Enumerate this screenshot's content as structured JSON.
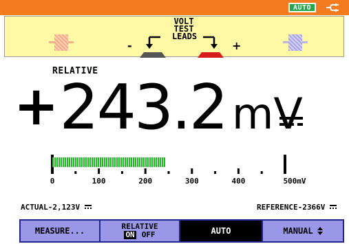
{
  "status_bar": {
    "mode_badge": "AUTO",
    "power_icon": "ac-plug-icon",
    "bar_color": "#f47b20",
    "badge_color": "#22a84a"
  },
  "connection_panel": {
    "title_lines": [
      "VOLT",
      "TEST",
      "LEADS"
    ],
    "minus_sign": "-",
    "plus_sign": "+",
    "left_probe_color": "#f6a87e",
    "right_probe_color": "#a7a3e6",
    "panel_color": "#fff9a6"
  },
  "measurement": {
    "mode": "RELATIVE",
    "sign": "+",
    "value": "243.2",
    "unit": "mV",
    "dc_icon": "dc-symbol-icon"
  },
  "bargraph": {
    "scale_labels": [
      "0",
      "100",
      "200",
      "300",
      "400",
      "500mV"
    ],
    "scale_min": 0,
    "scale_max": 500,
    "level": 243.2,
    "fill_color": "#18c01e"
  },
  "readouts": {
    "actual": "ACTUAL-2,123V",
    "reference": "REFERENCE-2366V"
  },
  "softkeys": {
    "measure": "MEASURE...",
    "relative_label": "RELATIVE",
    "relative_on": "ON",
    "relative_off": "OFF",
    "auto": "AUTO",
    "manual": "MANUAL",
    "manual_icon": "up-down-chevron-icon",
    "key_color": "#9a97e8",
    "bar_color": "#22258c"
  }
}
